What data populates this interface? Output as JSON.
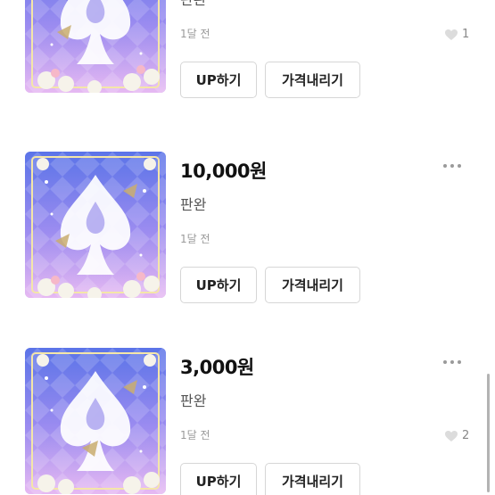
{
  "listings": [
    {
      "price": "",
      "status": "판완",
      "time": "1달 전",
      "like_count": "1",
      "up_label": "UP하기",
      "price_down_label": "가격내리기"
    },
    {
      "price": "10,000원",
      "status": "판완",
      "time": "1달 전",
      "like_count": "",
      "up_label": "UP하기",
      "price_down_label": "가격내리기"
    },
    {
      "price": "3,000원",
      "status": "판완",
      "time": "1달 전",
      "like_count": "2",
      "up_label": "UP하기",
      "price_down_label": "가격내리기"
    }
  ],
  "icons": {
    "more": "more-dots-icon",
    "like": "heart-icon"
  },
  "colors": {
    "price_text": "#111111",
    "muted_text": "#9a9a9a",
    "button_border": "#d6d6d6",
    "thumb_base": "#c9c3f3"
  }
}
